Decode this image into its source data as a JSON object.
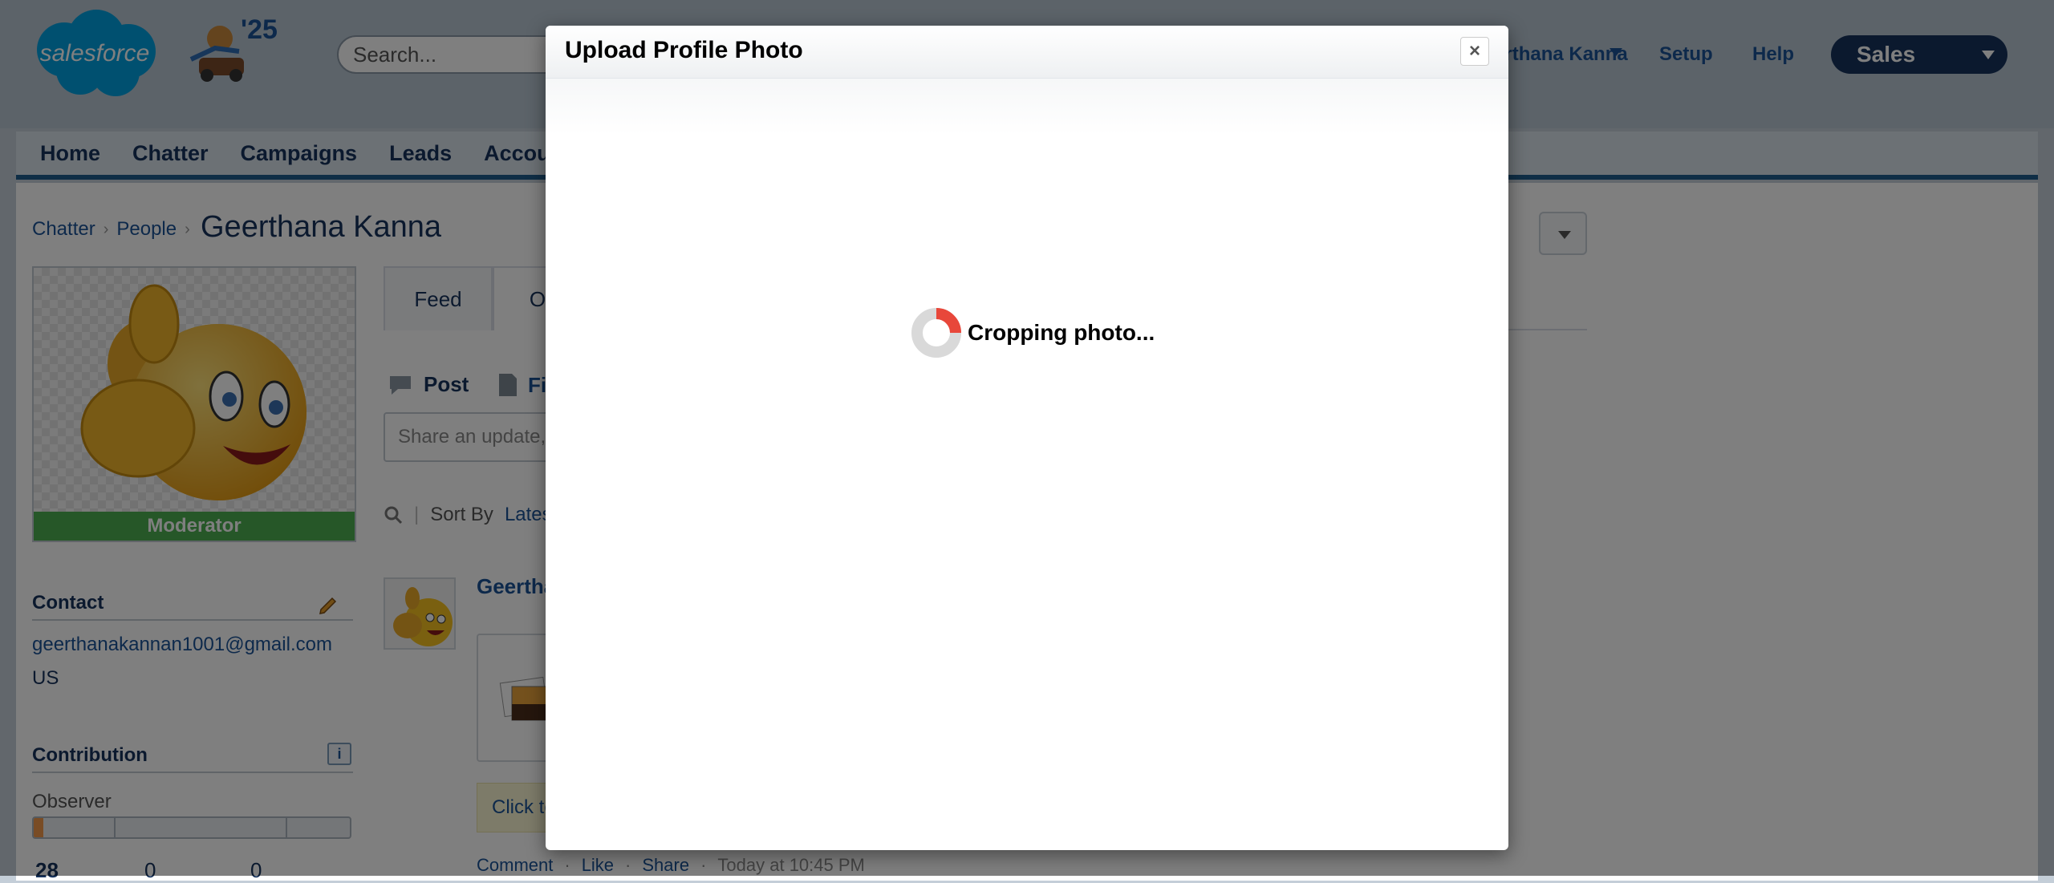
{
  "header": {
    "search_placeholder": "Search...",
    "user_name": "Geerthana Kanna",
    "setup": "Setup",
    "help": "Help",
    "app_name": "Sales",
    "release_label": "'25"
  },
  "nav": {
    "tabs": [
      "Home",
      "Chatter",
      "Campaigns",
      "Leads",
      "Accounts"
    ]
  },
  "breadcrumb": {
    "items": [
      "Chatter",
      "People"
    ],
    "title": "Geerthana Kanna"
  },
  "profile": {
    "badge": "Moderator",
    "contact_title": "Contact",
    "email": "geerthanakannan1001@gmail.com",
    "country": "US",
    "contribution_title": "Contribution",
    "info_label": "i",
    "level": "Observer",
    "level_progress": 0.03,
    "stats": [
      "28",
      "0",
      "0"
    ]
  },
  "feed": {
    "tabs": [
      "Feed",
      "Overview"
    ],
    "publisher_post": "Post",
    "publisher_file": "File",
    "share_placeholder": "Share an update, @mention someone...",
    "sort_label": "Sort By",
    "sort_value": "Latest Posts",
    "post_author": "Geerthana Kanna",
    "click_text": "Click to view",
    "actions": [
      "Comment",
      "Like",
      "Share"
    ],
    "timestamp": "Today at 10:45 PM"
  },
  "modal": {
    "title": "Upload Profile Photo",
    "close_label": "×",
    "status": "Cropping photo..."
  },
  "colors": {
    "brand_blue": "#00a1e0",
    "navy": "#16325c",
    "spinner_accent": "#e8473a",
    "moderator_green": "#4caf50"
  }
}
